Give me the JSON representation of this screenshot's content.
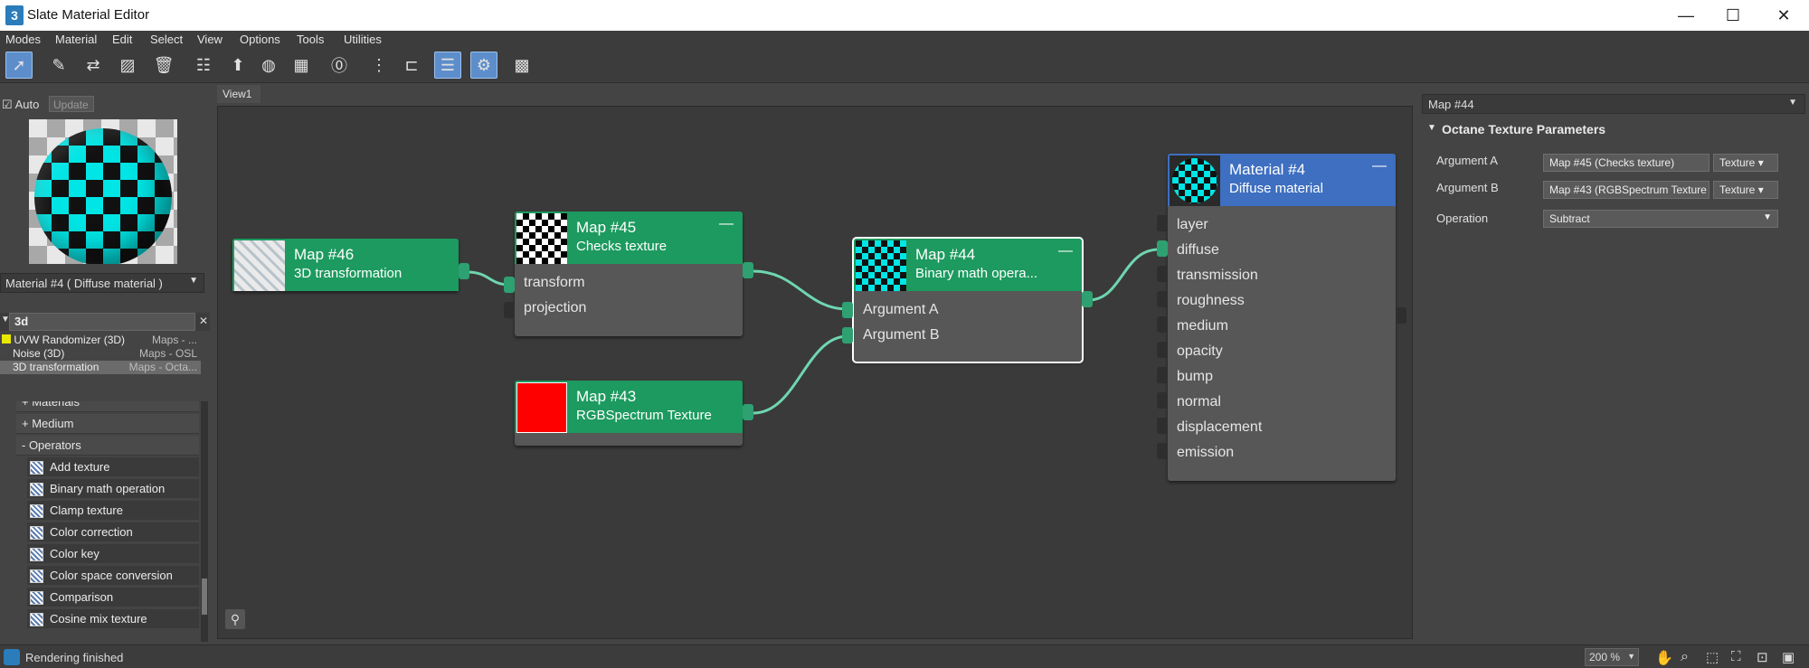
{
  "window": {
    "title": "Slate Material Editor",
    "app_icon": "3",
    "buttons": [
      "—",
      "☐",
      "✕"
    ]
  },
  "menu": [
    "Modes",
    "Material",
    "Edit",
    "Select",
    "View",
    "Options",
    "Tools",
    "Utilities"
  ],
  "preview": {
    "auto_label": "Auto",
    "update_label": "Update",
    "auto_checked": true
  },
  "material_selector": {
    "value": "Material #4  ( Diffuse material )"
  },
  "browser": {
    "search_value": "3d",
    "results": [
      {
        "name": "UVW Randomizer (3D)",
        "category": "Maps - ..."
      },
      {
        "name": "Noise (3D)",
        "category": "Maps - OSL"
      },
      {
        "name": "3D transformation",
        "category": "Maps - Octa..."
      }
    ],
    "groups": [
      "+ Materials",
      "+ Medium",
      "- Operators"
    ],
    "operators": [
      "Add texture",
      "Binary math operation",
      "Clamp texture",
      "Color correction",
      "Color key",
      "Color space conversion",
      "Comparison",
      "Cosine mix texture"
    ]
  },
  "view_tab": "View1",
  "nodes": {
    "map46": {
      "title": "Map #46",
      "subtitle": "3D transformation"
    },
    "map45": {
      "title": "Map #45",
      "subtitle": "Checks texture",
      "ports": [
        "transform",
        "projection"
      ]
    },
    "map43": {
      "title": "Map #43",
      "subtitle": "RGBSpectrum Texture"
    },
    "map44": {
      "title": "Map #44",
      "subtitle": "Binary math opera...",
      "ports": [
        "Argument A",
        "Argument B"
      ]
    },
    "material4": {
      "title": "Material #4",
      "subtitle": "Diffuse material",
      "ports": [
        "layer",
        "diffuse",
        "transmission",
        "roughness",
        "medium",
        "opacity",
        "bump",
        "normal",
        "displacement",
        "emission"
      ]
    }
  },
  "properties": {
    "header": "Map #44",
    "rollout": "Octane Texture Parameters",
    "rows": [
      {
        "label": "Argument A",
        "value": "Map #45 (Checks texture)",
        "type": "Texture"
      },
      {
        "label": "Argument B",
        "value": "Map #43 (RGBSpectrum Texture",
        "type": "Texture"
      }
    ],
    "operation_label": "Operation",
    "operation_value": "Subtract"
  },
  "status": {
    "text": "Rendering finished",
    "zoom": "200 %"
  },
  "colors": {
    "node_header": "#1d9a5f",
    "material_header": "#3e6fc0",
    "wire": "#6fd6b0",
    "accent": "#5d8ecb"
  }
}
